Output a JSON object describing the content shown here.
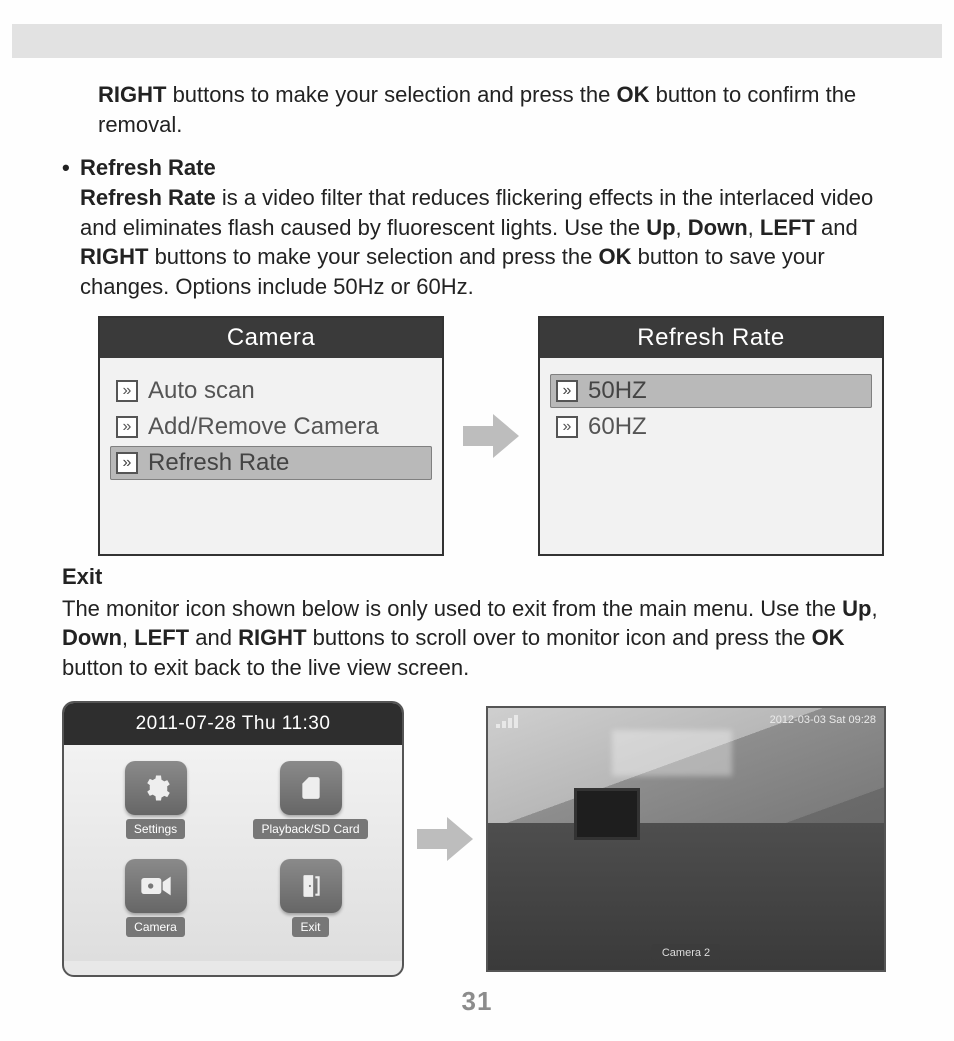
{
  "page_number": "31",
  "intro_fragment": {
    "bold_right": "RIGHT",
    "mid1": " buttons to make your selection and press the ",
    "bold_ok": "OK",
    "mid2": " button to confirm the removal."
  },
  "refresh_section": {
    "heading": "Refresh Rate",
    "lead_bold": "Refresh Rate",
    "lead_rest": " is a video filter that reduces flickering effects in the interlaced video and eliminates flash caused by fluorescent lights. Use the ",
    "b_up": "Up",
    "sep1": ", ",
    "b_down": "Down",
    "sep2": ", ",
    "b_left": "LEFT",
    "sep3": " and ",
    "b_right": "RIGHT",
    "mid": " buttons to make your selection and press the ",
    "b_ok": "OK",
    "tail": " button to save your changes. Options include 50Hz or 60Hz."
  },
  "camera_menu": {
    "title": "Camera",
    "items": [
      "Auto scan",
      "Add/Remove Camera",
      "Refresh Rate"
    ],
    "selected_index": 2
  },
  "refresh_menu": {
    "title": "Refresh Rate",
    "items": [
      "50HZ",
      "60HZ"
    ],
    "selected_index": 0
  },
  "exit_section": {
    "heading": "Exit",
    "pre": "The monitor icon shown below is only used to exit from the main menu. Use the ",
    "b_up": "Up",
    "sep1": ", ",
    "b_down": "Down",
    "sep2": ", ",
    "b_left": "LEFT",
    "sep3": " and ",
    "b_right": "RIGHT",
    "mid": " buttons to scroll over to monitor icon and press the ",
    "b_ok": "OK",
    "tail": " button to exit back to the live view screen."
  },
  "device_menu": {
    "timestamp": "2011-07-28 Thu  11:30",
    "tiles": {
      "settings": "Settings",
      "playback": "Playback/SD Card",
      "camera": "Camera",
      "exit": "Exit"
    }
  },
  "live_view": {
    "timestamp": "2012-03-03 Sat 09:28",
    "camera_label": "Camera 2"
  }
}
